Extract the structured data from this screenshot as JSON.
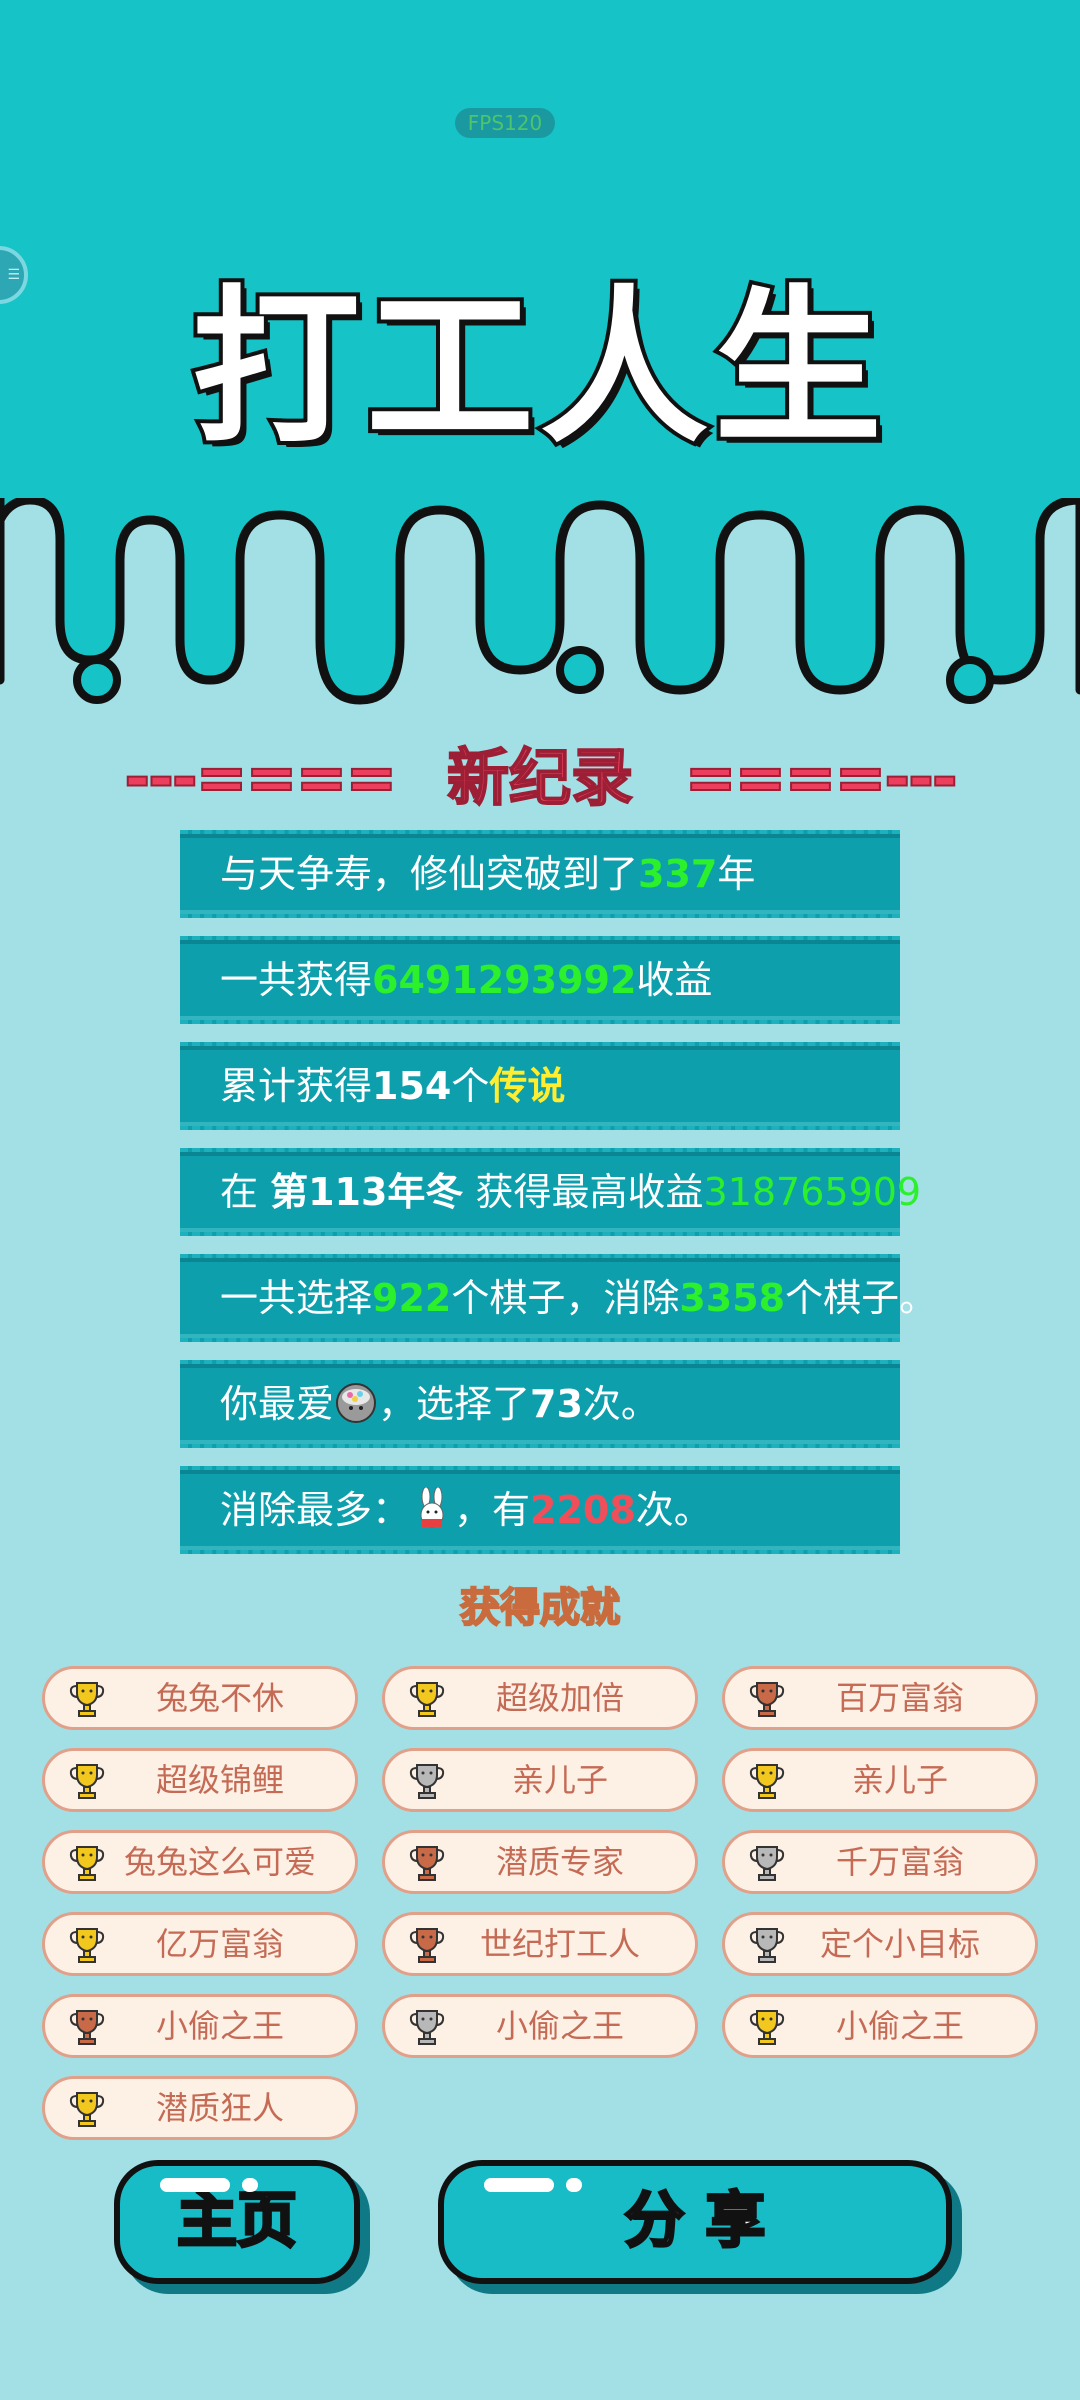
{
  "status": {
    "fps": "FPS120"
  },
  "header": {
    "title": "打工人生"
  },
  "record": {
    "dashes_left": "---====",
    "title": "新纪录",
    "dashes_right": "====---"
  },
  "stats": {
    "row1": {
      "pre": "与天争寿，修仙突破到了",
      "num": "337",
      "post": "年"
    },
    "row2": {
      "pre": "一共获得",
      "num": "6491293992",
      "post": "收益"
    },
    "row3": {
      "pre": "累计获得",
      "num": "154",
      "mid": "个",
      "tag": "传说"
    },
    "row4": {
      "pre": "在 ",
      "season": "第113年冬",
      "mid": " 获得最高收益",
      "num": "318765909"
    },
    "row5": {
      "pre": "一共选择",
      "num1": "922",
      "mid": "个棋子，消除",
      "num2": "3358",
      "post": "个棋子。"
    },
    "row6": {
      "pre": "你最爱",
      "mid": "，选择了",
      "num": "73",
      "post": "次。"
    },
    "row7": {
      "pre": "消除最多：",
      "mid": "，有",
      "num": "2208",
      "post": "次。"
    }
  },
  "achievements": {
    "title": "获得成就",
    "items": [
      {
        "label": "兔兔不休",
        "tier": "gold"
      },
      {
        "label": "超级加倍",
        "tier": "gold"
      },
      {
        "label": "百万富翁",
        "tier": "bronze"
      },
      {
        "label": "超级锦鲤",
        "tier": "gold"
      },
      {
        "label": "亲儿子",
        "tier": "silver"
      },
      {
        "label": "亲儿子",
        "tier": "gold"
      },
      {
        "label": "兔兔这么可爱",
        "tier": "gold"
      },
      {
        "label": "潜质专家",
        "tier": "bronze"
      },
      {
        "label": "千万富翁",
        "tier": "silver"
      },
      {
        "label": "亿万富翁",
        "tier": "gold"
      },
      {
        "label": "世纪打工人",
        "tier": "bronze"
      },
      {
        "label": "定个小目标",
        "tier": "silver"
      },
      {
        "label": "小偷之王",
        "tier": "bronze"
      },
      {
        "label": "小偷之王",
        "tier": "silver"
      },
      {
        "label": "小偷之王",
        "tier": "gold"
      },
      {
        "label": "潜质狂人",
        "tier": "gold"
      }
    ]
  },
  "buttons": {
    "home": "主页",
    "share": "分 享"
  },
  "colors": {
    "gold": "#f2c81e",
    "silver": "#b8b8b8",
    "bronze": "#c86a48"
  }
}
